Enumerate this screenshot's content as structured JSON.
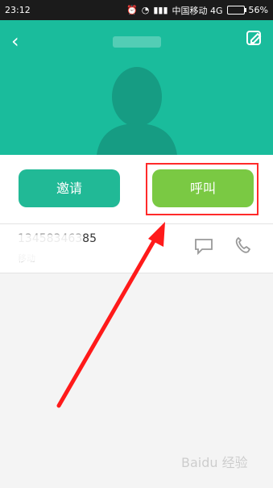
{
  "status_bar": {
    "time": "23:12",
    "carrier": "中国移动 4G",
    "battery": "56%",
    "battery_level": 0.56,
    "icons": [
      "alarm-icon",
      "wifi-icon",
      "signal-icon",
      "battery-icon"
    ]
  },
  "contact": {
    "name": "",
    "phone_number": "13458346385",
    "carrier": "移动"
  },
  "actions": {
    "invite_label": "邀请",
    "call_label": "呼叫"
  },
  "colors": {
    "header": "#1abc9c",
    "invite_button": "#21b996",
    "call_button": "#7ac943",
    "highlight": "#ff2a2a"
  },
  "watermark": "Baidu 经验"
}
